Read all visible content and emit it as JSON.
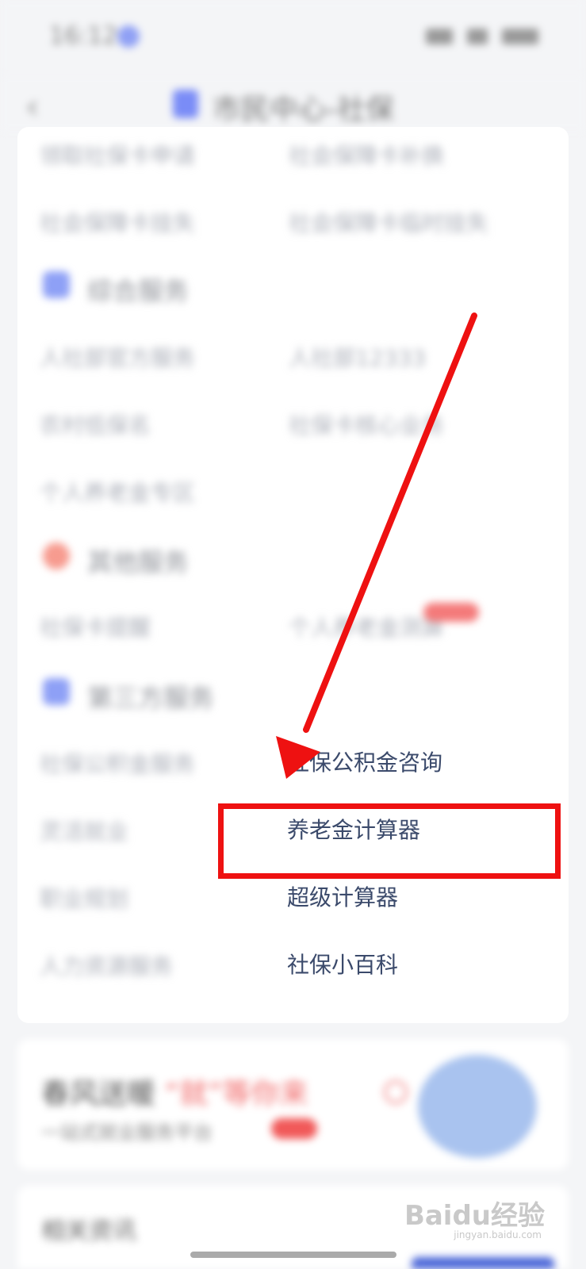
{
  "status_bar": {
    "time": "16:12"
  },
  "nav": {
    "title": "市民中心-社保"
  },
  "blurred_rows": [
    {
      "left": "领取社保卡申请",
      "right": "社会保障卡补换"
    },
    {
      "left": "社会保障卡挂失",
      "right": "社会保障卡临时挂失"
    }
  ],
  "sections": {
    "comprehensive": {
      "title": "综合服务",
      "rows": [
        {
          "left": "人社部官方服务",
          "right": "人社部12333"
        },
        {
          "left": "农村低保名",
          "right": "社保卡核心业务"
        },
        {
          "left": "个人养老金专区",
          "right": ""
        }
      ]
    },
    "other": {
      "title": "其他服务",
      "rows": [
        {
          "left": "社保卡提醒",
          "right": "个人养老金测算"
        }
      ]
    },
    "third_party": {
      "title": "第三方服务",
      "left_items": [
        "社保公积金服务",
        "灵活就业",
        "职业规划",
        "人力资源服务"
      ],
      "right_items": [
        "社保公积金咨询",
        "养老金计算器",
        "超级计算器",
        "社保小百科"
      ]
    }
  },
  "banner": {
    "title_main": "春风送暖",
    "title_accent": "“就”等你来",
    "subtitle": "一站式就业服务平台"
  },
  "bottom": {
    "title": "相关资讯"
  },
  "watermark": {
    "main": "Baidu经验",
    "sub": "jingyan.baidu.com"
  },
  "annotation": {
    "color": "#ee1111"
  }
}
